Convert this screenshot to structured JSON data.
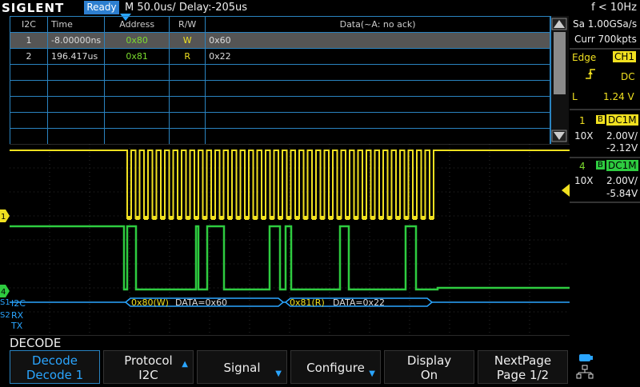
{
  "topbar": {
    "logo": "SIGLENT",
    "status": "Ready",
    "timebase": "M 50.0us/  Delay:-205us",
    "trigger_freq": "f < 10Hz"
  },
  "table": {
    "headers": [
      "I2C",
      "Time",
      "Address",
      "R/W",
      "Data(~A: no ack)"
    ],
    "rows": [
      {
        "index": "1",
        "time": "-8.00000ns",
        "address": "0x80",
        "rw": "W",
        "data": "0x60"
      },
      {
        "index": "2",
        "time": "196.417us",
        "address": "0x81",
        "rw": "R",
        "data": "0x22"
      }
    ]
  },
  "right_panel": {
    "sample_rate": "Sa 1.00GSa/s",
    "memory": "Curr 700kpts",
    "trigger_type": "Edge",
    "trigger_source": "CH1",
    "coupling": "DC",
    "level_label": "L",
    "level": "1.24 V",
    "ch1": {
      "num": "1",
      "bw": "B",
      "coupling": "DC1M",
      "probe": "10X",
      "vdiv": "2.00V/",
      "offset": "-2.12V"
    },
    "ch4": {
      "num": "4",
      "bw": "B",
      "coupling": "DC1M",
      "probe": "10X",
      "vdiv": "2.00V/",
      "offset": "-5.84V"
    }
  },
  "waveform": {
    "ch1_marker": "1",
    "ch4_marker": "4",
    "bus1_label": "I2C",
    "bus1_marker": "S1",
    "bus2_marker": "S2",
    "bus2_rx": "RX",
    "bus2_tx": "TX",
    "decode_frames": [
      {
        "address": "0x80(W)",
        "data": "DATA=0x60"
      },
      {
        "address": "0x81(R)",
        "data": "DATA=0x22"
      }
    ]
  },
  "menu": {
    "title": "DECODE",
    "keys": [
      {
        "line1": "Decode",
        "line2": "Decode 1"
      },
      {
        "line1": "Protocol",
        "line2": "I2C"
      },
      {
        "line1": "Signal",
        "line2": ""
      },
      {
        "line1": "Configure",
        "line2": ""
      },
      {
        "line1": "Display",
        "line2": "On"
      },
      {
        "line1": "NextPage",
        "line2": "Page 1/2"
      }
    ]
  },
  "colors": {
    "ch1": "#f0e020",
    "ch4": "#2ecc40",
    "accent": "#2aa5ff",
    "grid": "#2a83c0"
  }
}
